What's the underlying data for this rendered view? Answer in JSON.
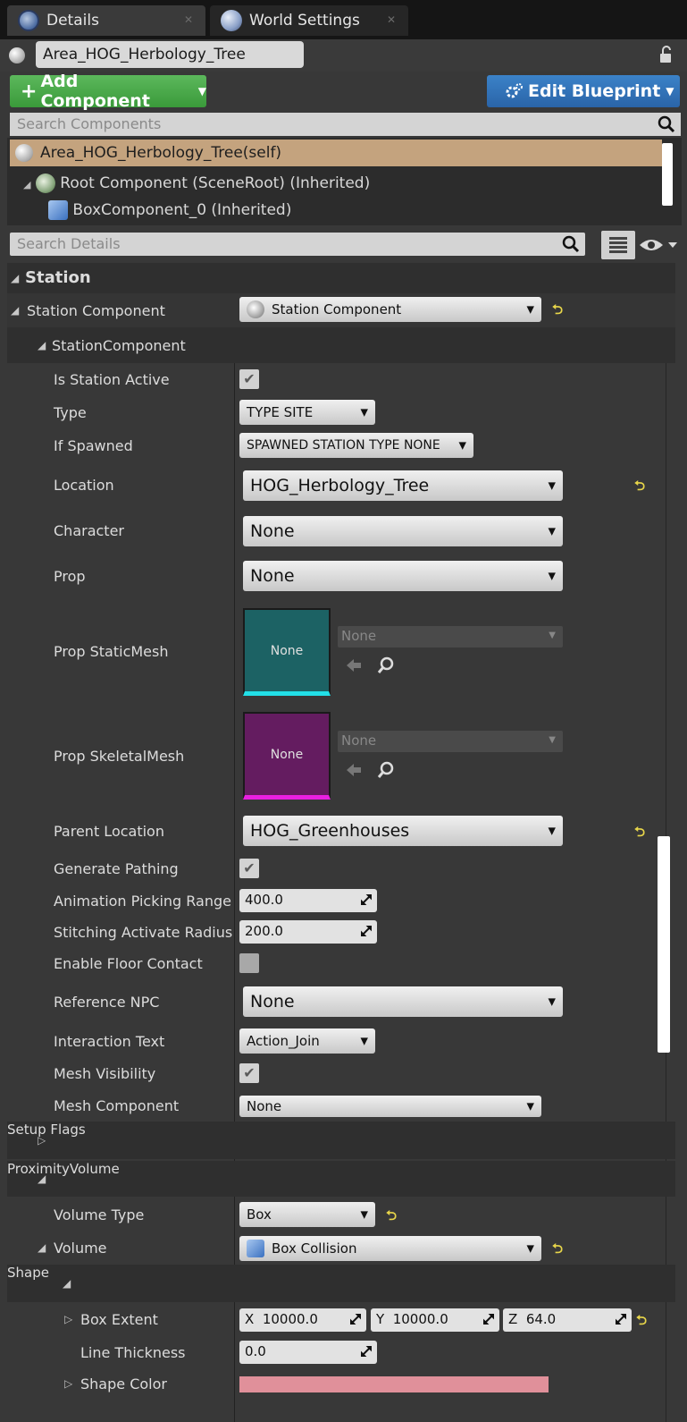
{
  "tabs": [
    {
      "label": "Details",
      "icon": "details-icon",
      "active": true
    },
    {
      "label": "World Settings",
      "icon": "world-icon",
      "active": false
    }
  ],
  "actor": {
    "name": "Area_HOG_Herbology_Tree"
  },
  "toolbar": {
    "add_component": "Add Component",
    "edit_blueprint": "Edit Blueprint"
  },
  "component_search": {
    "placeholder": "Search Components"
  },
  "components": {
    "self": "Area_HOG_Herbology_Tree(self)",
    "root": "Root Component (SceneRoot) (Inherited)",
    "box": "BoxComponent_0 (Inherited)"
  },
  "details_search": {
    "placeholder": "Search Details"
  },
  "station": {
    "category": "Station",
    "station_component_label": "Station Component",
    "station_component_value": "Station Component",
    "sub_category": "StationComponent",
    "is_station_active": {
      "label": "Is Station Active",
      "checked": true
    },
    "type": {
      "label": "Type",
      "value": "TYPE SITE"
    },
    "if_spawned": {
      "label": "If Spawned",
      "value": "SPAWNED STATION TYPE NONE"
    },
    "location": {
      "label": "Location",
      "value": "HOG_Herbology_Tree"
    },
    "character": {
      "label": "Character",
      "value": "None"
    },
    "prop": {
      "label": "Prop",
      "value": "None"
    },
    "prop_static_mesh": {
      "label": "Prop StaticMesh",
      "thumb": "None",
      "value": "None"
    },
    "prop_skeletal_mesh": {
      "label": "Prop SkeletalMesh",
      "thumb": "None",
      "value": "None"
    },
    "parent_location": {
      "label": "Parent Location",
      "value": "HOG_Greenhouses"
    },
    "generate_pathing": {
      "label": "Generate Pathing",
      "checked": true
    },
    "animation_picking_range": {
      "label": "Animation Picking Range",
      "value": "400.0"
    },
    "stitching_activate_radius": {
      "label": "Stitching Activate Radius",
      "value": "200.0"
    },
    "enable_floor_contact": {
      "label": "Enable Floor Contact",
      "checked": false
    },
    "reference_npc": {
      "label": "Reference NPC",
      "value": "None"
    },
    "interaction_text": {
      "label": "Interaction Text",
      "value": "Action_Join"
    },
    "mesh_visibility": {
      "label": "Mesh Visibility",
      "checked": true
    },
    "mesh_component": {
      "label": "Mesh Component",
      "value": "None"
    }
  },
  "setup_flags": {
    "label": "Setup Flags"
  },
  "proximity": {
    "category": "ProximityVolume",
    "volume_type": {
      "label": "Volume Type",
      "value": "Box"
    },
    "volume": {
      "label": "Volume",
      "value": "Box Collision"
    },
    "shape": {
      "label": "Shape"
    },
    "box_extent": {
      "label": "Box Extent",
      "x_label": "X",
      "x": "10000.0",
      "y_label": "Y",
      "y": "10000.0",
      "z_label": "Z",
      "z": "64.0"
    },
    "line_thickness": {
      "label": "Line Thickness",
      "value": "0.0"
    },
    "shape_color": {
      "label": "Shape Color",
      "color": "#e0909a"
    }
  },
  "colors": {
    "add_button": "#4aa84a",
    "edit_button": "#2f72b8",
    "selected_row": "#c4a37e",
    "reset_arrow": "#e8d64a",
    "static_mesh_thumb": "#1c6264",
    "skeletal_mesh_thumb": "#641c60"
  }
}
